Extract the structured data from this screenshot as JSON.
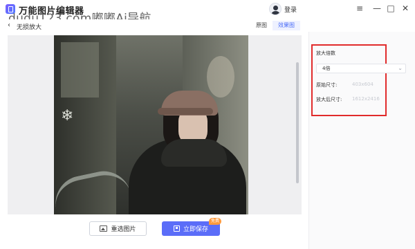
{
  "app": {
    "title": "万能图片编辑器",
    "watermark": "dudu123.com嘟嘟Ai导航"
  },
  "header": {
    "login_label": "登录",
    "window_controls": {
      "menu": "≡",
      "minimize": "—",
      "maximize": "□",
      "close": "✕"
    }
  },
  "subheader": {
    "back_icon": "‹",
    "page_title": "无损放大"
  },
  "view_tabs": [
    {
      "label": "原图",
      "active": false
    },
    {
      "label": "效果图",
      "active": true
    }
  ],
  "actions": {
    "reselect_label": "重选图片",
    "save_label": "立即保存",
    "free_badge": "免费"
  },
  "settings": {
    "scale_label": "放大倍数",
    "scale_value": "4倍",
    "original_size_label": "原始尺寸:",
    "original_size_value": "403x604",
    "enlarged_size_label": "放大后尺寸:",
    "enlarged_size_value": "1612x2416"
  },
  "colors": {
    "accent": "#5b6df8",
    "highlight_border": "#e12b2b",
    "badge": "#ff9a3c"
  }
}
